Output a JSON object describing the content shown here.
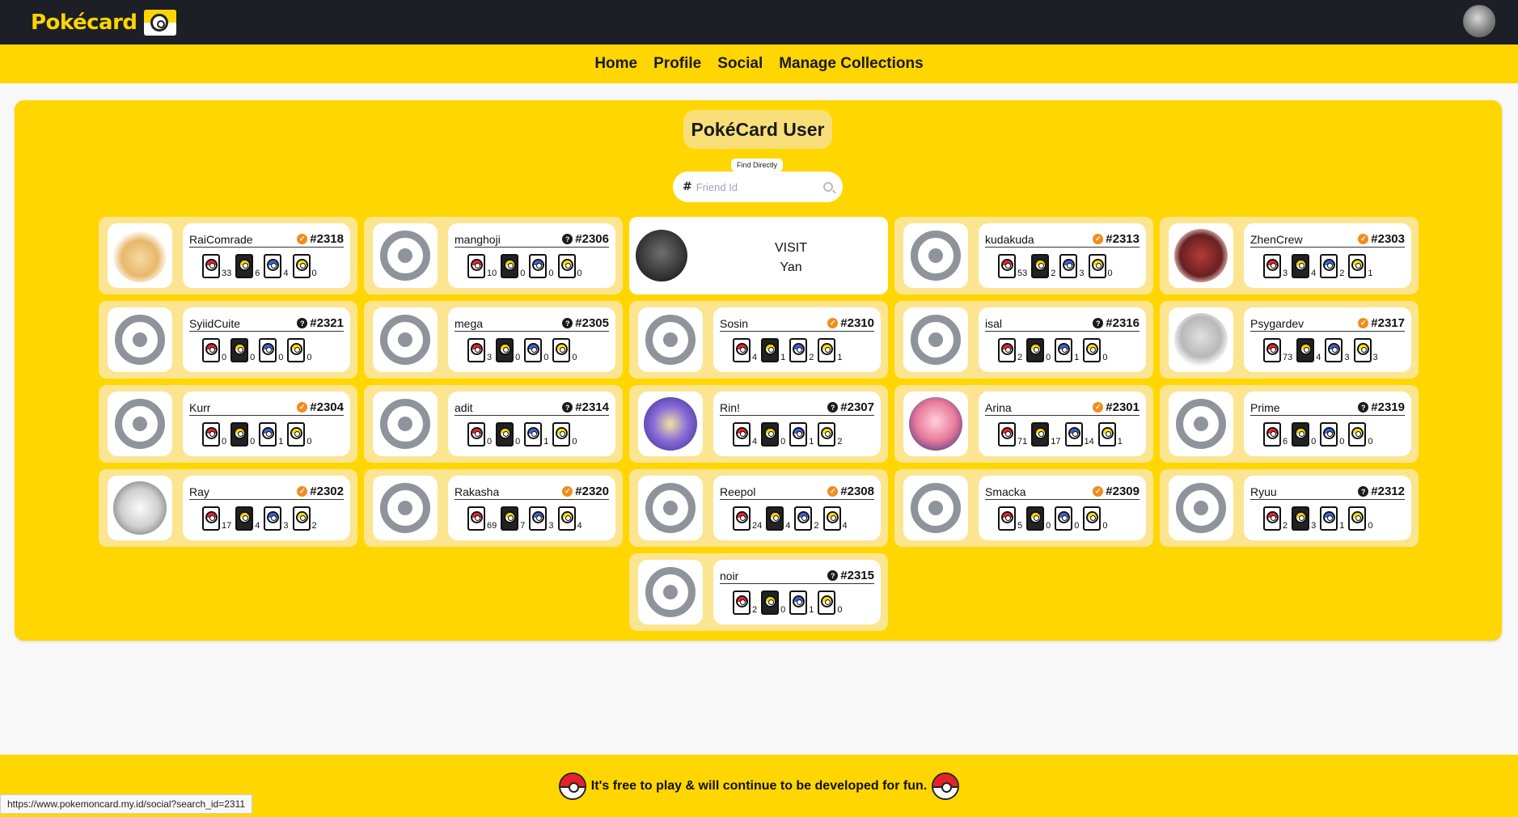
{
  "brand": {
    "name": "Pokécard"
  },
  "nav": {
    "items": [
      "Home",
      "Profile",
      "Social",
      "Manage Collections"
    ]
  },
  "page": {
    "title": "PokéCard User"
  },
  "search": {
    "label": "Find Directly",
    "hash": "#",
    "placeholder": "Friend Id"
  },
  "visit": {
    "line1": "VISIT",
    "line2": "Yan"
  },
  "users": [
    {
      "name": "RaiComrade",
      "id": "#2318",
      "verified": true,
      "avatar": "photo",
      "stats": [
        "33",
        "6",
        "4",
        "0"
      ]
    },
    {
      "name": "manghoji",
      "id": "#2306",
      "verified": false,
      "avatar": "ring",
      "stats": [
        "10",
        "0",
        "0",
        "0"
      ]
    },
    {
      "name": "kudakuda",
      "id": "#2313",
      "verified": true,
      "avatar": "ring",
      "stats": [
        "53",
        "2",
        "3",
        "0"
      ]
    },
    {
      "name": "ZhenCrew",
      "id": "#2303",
      "verified": true,
      "avatar": "photo",
      "stats": [
        "3",
        "4",
        "2",
        "1"
      ]
    },
    {
      "name": "SyiidCuite",
      "id": "#2321",
      "verified": false,
      "avatar": "ring",
      "stats": [
        "0",
        "0",
        "0",
        "0"
      ]
    },
    {
      "name": "mega",
      "id": "#2305",
      "verified": false,
      "avatar": "ring",
      "stats": [
        "3",
        "0",
        "0",
        "0"
      ]
    },
    {
      "name": "Sosin",
      "id": "#2310",
      "verified": true,
      "avatar": "ring",
      "stats": [
        "4",
        "1",
        "2",
        "1"
      ]
    },
    {
      "name": "isal",
      "id": "#2316",
      "verified": false,
      "avatar": "ring",
      "stats": [
        "2",
        "0",
        "1",
        "0"
      ]
    },
    {
      "name": "Psygardev",
      "id": "#2317",
      "verified": true,
      "avatar": "photo",
      "stats": [
        "73",
        "4",
        "3",
        "3"
      ]
    },
    {
      "name": "Kurr",
      "id": "#2304",
      "verified": true,
      "avatar": "ring",
      "stats": [
        "0",
        "0",
        "1",
        "0"
      ]
    },
    {
      "name": "adit",
      "id": "#2314",
      "verified": false,
      "avatar": "ring",
      "stats": [
        "0",
        "0",
        "1",
        "0"
      ]
    },
    {
      "name": "Rin!",
      "id": "#2307",
      "verified": false,
      "avatar": "photo",
      "stats": [
        "4",
        "0",
        "1",
        "2"
      ]
    },
    {
      "name": "Arina",
      "id": "#2301",
      "verified": true,
      "avatar": "photo",
      "stats": [
        "71",
        "17",
        "14",
        "1"
      ]
    },
    {
      "name": "Prime",
      "id": "#2319",
      "verified": false,
      "avatar": "ring",
      "stats": [
        "6",
        "0",
        "0",
        "0"
      ]
    },
    {
      "name": "Ray",
      "id": "#2302",
      "verified": true,
      "avatar": "photo",
      "stats": [
        "17",
        "4",
        "3",
        "2"
      ]
    },
    {
      "name": "Rakasha",
      "id": "#2320",
      "verified": true,
      "avatar": "ring",
      "stats": [
        "69",
        "7",
        "3",
        "4"
      ]
    },
    {
      "name": "Reepol",
      "id": "#2308",
      "verified": true,
      "avatar": "ring",
      "stats": [
        "24",
        "4",
        "2",
        "4"
      ]
    },
    {
      "name": "Smacka",
      "id": "#2309",
      "verified": true,
      "avatar": "ring",
      "stats": [
        "5",
        "0",
        "0",
        "0"
      ]
    },
    {
      "name": "Ryuu",
      "id": "#2312",
      "verified": false,
      "avatar": "ring",
      "stats": [
        "2",
        "3",
        "1",
        "0"
      ]
    },
    {
      "name": "noir",
      "id": "#2315",
      "verified": false,
      "avatar": "ring",
      "stats": [
        "2",
        "0",
        "1",
        "0"
      ]
    }
  ],
  "footer": {
    "text": "It's free to play & will continue to be developed for fun."
  },
  "status": {
    "url": "https://www.pokemoncard.my.id/social?search_id=2311"
  },
  "colors": {
    "brand_yellow": "#ffd600",
    "dark": "#1c1f25",
    "card_bg": "#fbe590",
    "verified": "#f28c1e"
  }
}
